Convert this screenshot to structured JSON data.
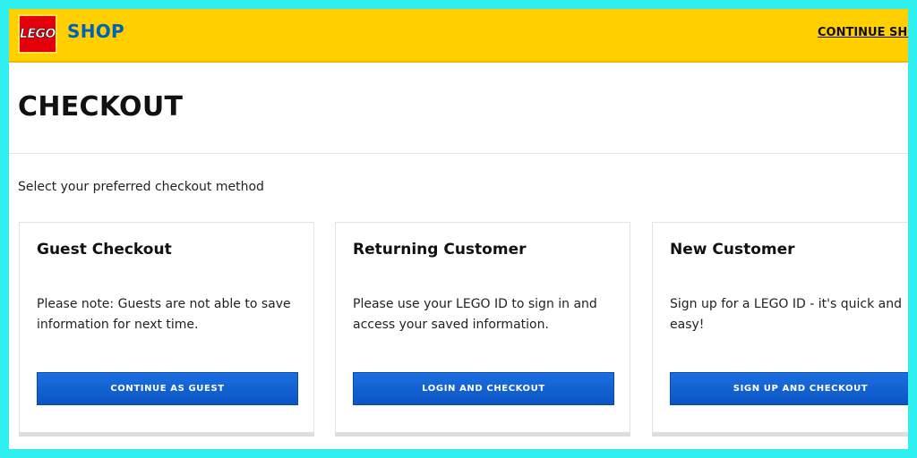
{
  "header": {
    "logo_text": "LEGO",
    "shop_label": "SHOP",
    "continue_label": "CONTINUE SHOP"
  },
  "page": {
    "title": "CHECKOUT",
    "instruction": "Select your preferred checkout method"
  },
  "cards": [
    {
      "title": "Guest Checkout",
      "body": "Please note: Guests are not able to save information for next time.",
      "button": "CONTINUE AS GUEST"
    },
    {
      "title": "Returning Customer",
      "body": "Please use your LEGO ID to sign in and access your saved information.",
      "button": "LOGIN AND CHECKOUT"
    },
    {
      "title": "New Customer",
      "body": "Sign up for a LEGO ID - it's quick and easy!",
      "button": "SIGN UP AND CHECKOUT"
    }
  ],
  "colors": {
    "header_bg": "#ffcf00",
    "brand_red": "#e3000b",
    "shop_blue": "#0061b8",
    "button_blue": "#0b55c2",
    "border_cyan": "#2ff0f0"
  }
}
